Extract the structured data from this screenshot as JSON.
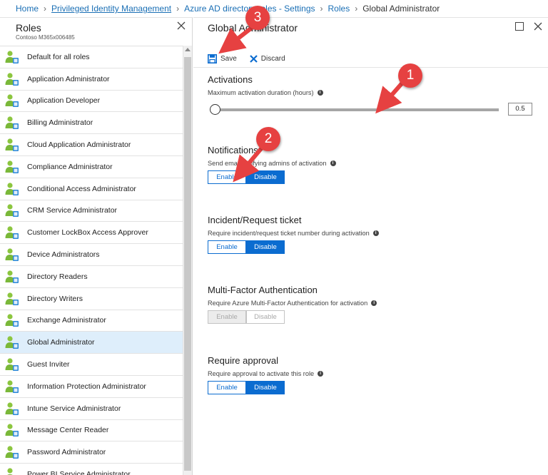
{
  "breadcrumb": {
    "items": [
      {
        "label": "Home",
        "style": "plain"
      },
      {
        "label": "Privileged Identity Management",
        "style": "link"
      },
      {
        "label": "Azure AD directory roles - Settings",
        "style": "plain"
      },
      {
        "label": "Roles",
        "style": "plain"
      },
      {
        "label": "Global Administrator",
        "style": "current"
      }
    ]
  },
  "left_blade": {
    "title": "Roles",
    "subtitle": "Contoso M365x006485",
    "roles": [
      "Default for all roles",
      "Application Administrator",
      "Application Developer",
      "Billing Administrator",
      "Cloud Application Administrator",
      "Compliance Administrator",
      "Conditional Access Administrator",
      "CRM Service Administrator",
      "Customer LockBox Access Approver",
      "Device Administrators",
      "Directory Readers",
      "Directory Writers",
      "Exchange Administrator",
      "Global Administrator",
      "Guest Inviter",
      "Information Protection Administrator",
      "Intune Service Administrator",
      "Message Center Reader",
      "Password Administrator",
      "Power BI Service Administrator"
    ],
    "selected_role": "Global Administrator"
  },
  "right_blade": {
    "title": "Global Administrator",
    "toolbar": {
      "save_label": "Save",
      "discard_label": "Discard"
    },
    "activations": {
      "title": "Activations",
      "description": "Maximum activation duration (hours)",
      "value": "0.5"
    },
    "notifications": {
      "title": "Notifications",
      "description": "Send email notifying admins of activation",
      "enable_label": "Enable",
      "disable_label": "Disable",
      "selected": "Disable"
    },
    "incident": {
      "title": "Incident/Request ticket",
      "description": "Require incident/request ticket number during activation",
      "enable_label": "Enable",
      "disable_label": "Disable",
      "selected": "Disable"
    },
    "mfa": {
      "title": "Multi-Factor Authentication",
      "description": "Require Azure Multi-Factor Authentication for activation",
      "enable_label": "Enable",
      "disable_label": "Disable",
      "state": "disabled"
    },
    "approval": {
      "title": "Require approval",
      "description": "Require approval to activate this role",
      "enable_label": "Enable",
      "disable_label": "Disable",
      "selected": "Disable"
    }
  },
  "callouts": [
    "1",
    "2",
    "3"
  ],
  "colors": {
    "accent": "#0b6cd0",
    "link": "#1a6fb5",
    "selected_row": "#deeefb",
    "callout": "#e64141"
  }
}
